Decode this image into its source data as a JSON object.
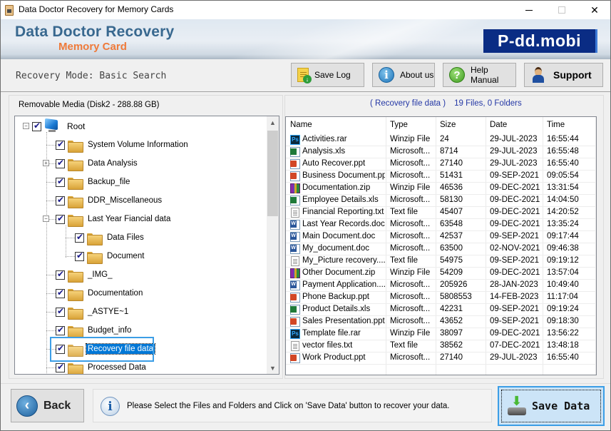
{
  "window": {
    "title": "Data Doctor Recovery for Memory Cards",
    "controls": {
      "minimize": "minimize",
      "maximize": "maximize",
      "close": "✕"
    }
  },
  "banner": {
    "brand_main": "Data Doctor Recovery",
    "brand_sub": "Memory Card",
    "logo": "P-dd.mobi"
  },
  "toolbar": {
    "mode_text": "Recovery Mode: Basic Search",
    "buttons": [
      {
        "label": "Save Log",
        "icon": "save-log-icon"
      },
      {
        "label": "About us",
        "icon": "info-icon",
        "glyph": "i"
      },
      {
        "label": "Help Manual",
        "icon": "help-icon",
        "glyph": "?"
      },
      {
        "label": "Support",
        "icon": "support-person-icon"
      }
    ]
  },
  "left_panel": {
    "media_label": "Removable Media (Disk2 - 288.88 GB)",
    "tree": [
      {
        "label": "Root",
        "level": 0,
        "expander": "−",
        "checked": true,
        "icon": "computer-icon"
      },
      {
        "label": "System Volume Information",
        "level": 1,
        "checked": true,
        "icon": "folder-icon"
      },
      {
        "label": "Data Analysis",
        "level": 1,
        "expander": "+",
        "checked": true,
        "icon": "folder-icon"
      },
      {
        "label": "Backup_file",
        "level": 1,
        "checked": true,
        "icon": "folder-icon"
      },
      {
        "label": "DDR_Miscellaneous",
        "level": 1,
        "checked": true,
        "icon": "folder-icon"
      },
      {
        "label": "Last Year Fiancial data",
        "level": 1,
        "expander": "−",
        "checked": true,
        "icon": "folder-icon"
      },
      {
        "label": "Data Files",
        "level": 2,
        "checked": true,
        "icon": "folder-icon"
      },
      {
        "label": "Document",
        "level": 2,
        "checked": true,
        "icon": "folder-icon"
      },
      {
        "label": "_IMG_",
        "level": 1,
        "checked": true,
        "icon": "folder-icon"
      },
      {
        "label": "Documentation",
        "level": 1,
        "checked": true,
        "icon": "folder-icon"
      },
      {
        "label": "_ASTYE~1",
        "level": 1,
        "checked": true,
        "icon": "folder-icon"
      },
      {
        "label": "Budget_info",
        "level": 1,
        "checked": true,
        "icon": "folder-icon"
      },
      {
        "label": "Recovery file data",
        "level": 1,
        "checked": true,
        "icon": "folder-open-icon",
        "selected": true
      },
      {
        "label": "Processed Data",
        "level": 1,
        "checked": true,
        "icon": "folder-icon"
      }
    ]
  },
  "right_panel": {
    "current_folder": "( Recovery file data )",
    "count": "19 Files, 0 Folders",
    "columns": [
      "Name",
      "Type",
      "Size",
      "Date",
      "Time"
    ],
    "files": [
      {
        "icon": "ps",
        "name": "Activities.rar",
        "type": "Winzip File",
        "size": "24",
        "date": "29-JUL-2023",
        "time": "16:55:44"
      },
      {
        "icon": "xls",
        "name": "Analysis.xls",
        "type": "Microsoft...",
        "size": "8714",
        "date": "29-JUL-2023",
        "time": "16:55:48"
      },
      {
        "icon": "ppt",
        "name": "Auto Recover.ppt",
        "type": "Microsoft...",
        "size": "27140",
        "date": "29-JUL-2023",
        "time": "16:55:40"
      },
      {
        "icon": "ppt",
        "name": "Business Document.ppt",
        "type": "Microsoft...",
        "size": "51431",
        "date": "09-SEP-2021",
        "time": "09:05:54"
      },
      {
        "icon": "zip",
        "name": "Documentation.zip",
        "type": "Winzip File",
        "size": "46536",
        "date": "09-DEC-2021",
        "time": "13:31:54"
      },
      {
        "icon": "xls",
        "name": "Employee Details.xls",
        "type": "Microsoft...",
        "size": "58130",
        "date": "09-DEC-2021",
        "time": "14:04:50"
      },
      {
        "icon": "txt",
        "name": "Financial Reporting.txt",
        "type": "Text file",
        "size": "45407",
        "date": "09-DEC-2021",
        "time": "14:20:52"
      },
      {
        "icon": "doc",
        "name": "Last Year Records.doc",
        "type": "Microsoft...",
        "size": "63548",
        "date": "09-DEC-2021",
        "time": "13:35:24"
      },
      {
        "icon": "doc",
        "name": "Main Document.doc",
        "type": "Microsoft...",
        "size": "42537",
        "date": "09-SEP-2021",
        "time": "09:17:44"
      },
      {
        "icon": "doc",
        "name": "My_document.doc",
        "type": "Microsoft...",
        "size": "63500",
        "date": "02-NOV-2021",
        "time": "09:46:38"
      },
      {
        "icon": "txt",
        "name": "My_Picture recovery....",
        "type": "Text file",
        "size": "54975",
        "date": "09-SEP-2021",
        "time": "09:19:12"
      },
      {
        "icon": "zip",
        "name": "Other Document.zip",
        "type": "Winzip File",
        "size": "54209",
        "date": "09-DEC-2021",
        "time": "13:57:04"
      },
      {
        "icon": "doc",
        "name": "Payment Application....",
        "type": "Microsoft...",
        "size": "205926",
        "date": "28-JAN-2023",
        "time": "10:49:40"
      },
      {
        "icon": "ppt",
        "name": "Phone Backup.ppt",
        "type": "Microsoft...",
        "size": "5808553",
        "date": "14-FEB-2023",
        "time": "11:17:04"
      },
      {
        "icon": "xls",
        "name": "Product Details.xls",
        "type": "Microsoft...",
        "size": "42231",
        "date": "09-SEP-2021",
        "time": "09:19:24"
      },
      {
        "icon": "ppt",
        "name": "Sales Presentation.ppt",
        "type": "Microsoft...",
        "size": "43652",
        "date": "09-SEP-2021",
        "time": "09:18:30"
      },
      {
        "icon": "ps",
        "name": "Template file.rar",
        "type": "Winzip File",
        "size": "38097",
        "date": "09-DEC-2021",
        "time": "13:56:22"
      },
      {
        "icon": "txt",
        "name": "vector files.txt",
        "type": "Text file",
        "size": "38562",
        "date": "07-DEC-2021",
        "time": "13:48:18"
      },
      {
        "icon": "ppt",
        "name": "Work Product.ppt",
        "type": "Microsoft...",
        "size": "27140",
        "date": "29-JUL-2023",
        "time": "16:55:40"
      }
    ]
  },
  "footer": {
    "back_label": "Back",
    "info_text": "Please Select the Files and Folders and Click on 'Save Data' button to recover your data.",
    "save_label": "Save Data"
  }
}
